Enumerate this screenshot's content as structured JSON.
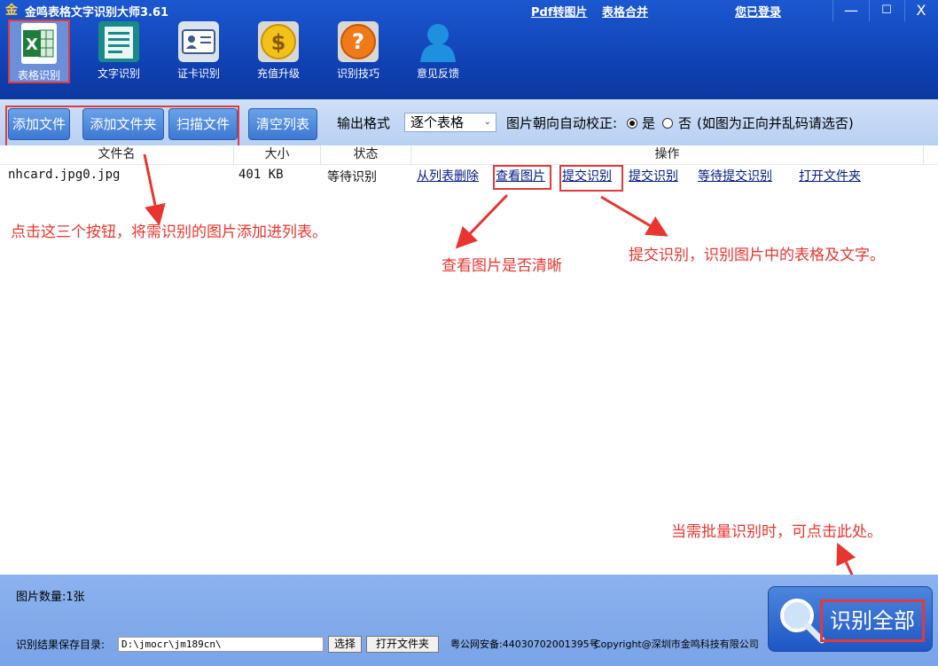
{
  "app": {
    "icon_char": "金",
    "title": "金鸣表格文字识别大师3.61"
  },
  "top_links": {
    "pdf_to_image": "Pdf转图片",
    "table_merge": "表格合并",
    "login": "您已登录"
  },
  "window_controls": {
    "minimize": "—",
    "maximize": "☐",
    "close": "X"
  },
  "toolbar": {
    "items": [
      {
        "label": "表格识别",
        "icon": "excel-icon",
        "active": true
      },
      {
        "label": "文字识别",
        "icon": "document-icon",
        "active": false
      },
      {
        "label": "证卡识别",
        "icon": "id-card-icon",
        "active": false
      },
      {
        "label": "充值升级",
        "icon": "coin-icon",
        "active": false
      },
      {
        "label": "识别技巧",
        "icon": "question-icon",
        "active": false
      },
      {
        "label": "意见反馈",
        "icon": "user-icon",
        "active": false
      }
    ]
  },
  "buttons": {
    "add_file": "添加文件",
    "add_folder": "添加文件夹",
    "scan_file": "扫描文件",
    "clear_list": "清空列表"
  },
  "options": {
    "output_format_label": "输出格式",
    "output_format_value": "逐个表格",
    "orientation_label": "图片朝向自动校正:",
    "yes": "是",
    "no": "否",
    "hint": "(如图为正向并乱码请选否)",
    "selected": "yes"
  },
  "table": {
    "columns": [
      "文件名",
      "大小",
      "状态",
      "操作"
    ],
    "rows": [
      {
        "filename": "nhcard.jpg0.jpg",
        "size": "401 KB",
        "status": "等待识别",
        "actions": [
          "从列表删除",
          "查看图片",
          "提交识别",
          "提交识别",
          "等待提交识别",
          "打开文件夹"
        ]
      }
    ]
  },
  "annotations": {
    "add_buttons_hint": "点击这三个按钮，将需识别的图片添加进列表。",
    "view_image_hint": "查看图片是否清晰",
    "submit_hint": "提交识别，识别图片中的表格及文字。",
    "batch_hint": "当需批量识别时，可点击此处。"
  },
  "bottom": {
    "image_count": "图片数量:1张",
    "save_dir_label": "识别结果保存目录:",
    "save_dir_value": "D:\\jmocr\\jm189cn\\",
    "choose_button": "选择",
    "open_folder_button": "打开文件夹",
    "icp": "粤公网安备:44030702001395号",
    "copyright": "Copyright@深圳市金鸣科技有限公司",
    "recognize_all": "识别全部"
  }
}
